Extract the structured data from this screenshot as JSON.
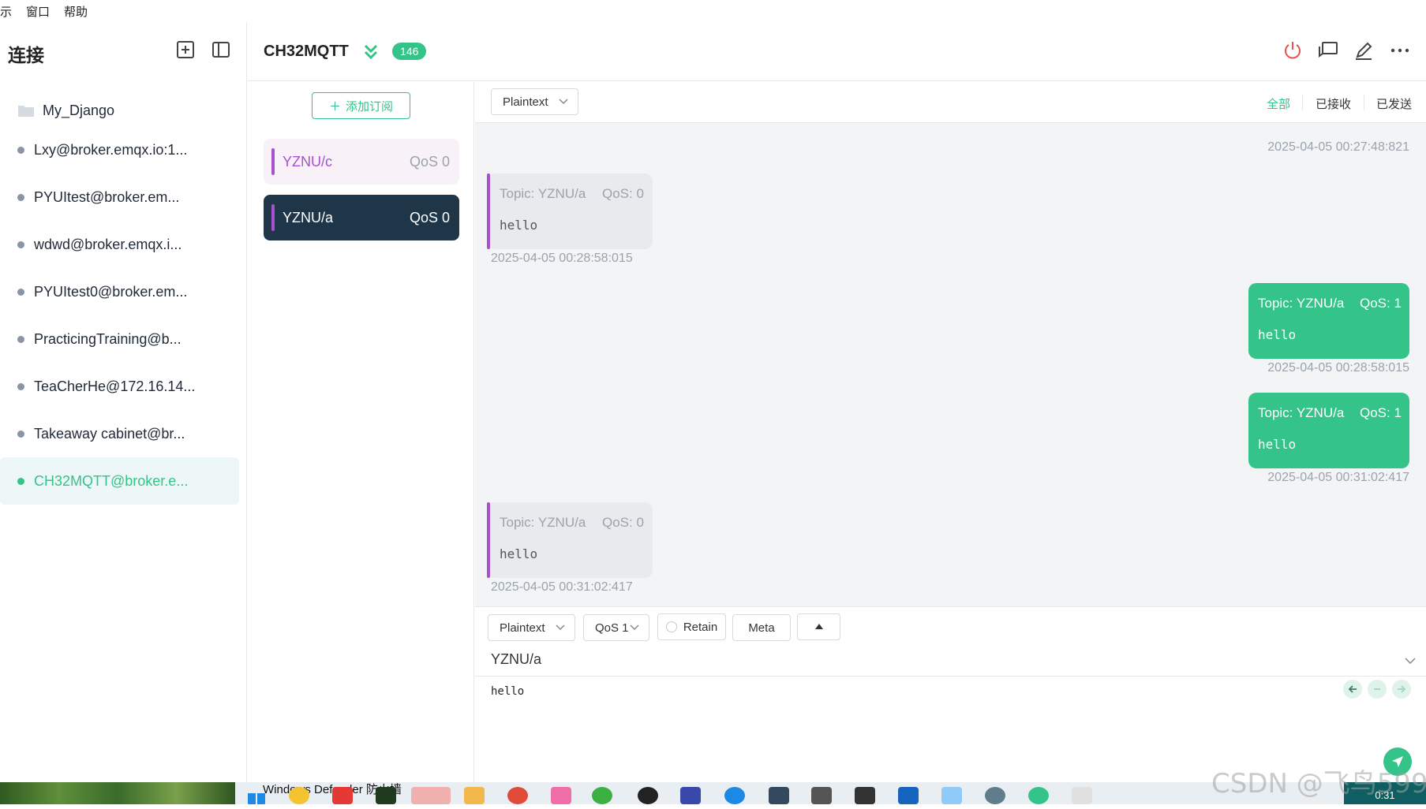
{
  "menubar": {
    "items": [
      "示",
      "窗口",
      "帮助"
    ]
  },
  "sidebar": {
    "title": "连接",
    "folder": {
      "label": "My_Django"
    },
    "connections": [
      {
        "label": "Lxy@broker.emqx.io:1...",
        "active": false
      },
      {
        "label": "PYUItest@broker.em...",
        "active": false
      },
      {
        "label": "wdwd@broker.emqx.i...",
        "active": false
      },
      {
        "label": "PYUItest0@broker.em...",
        "active": false
      },
      {
        "label": "PracticingTraining@b...",
        "active": false
      },
      {
        "label": "TeaCherHe@172.16.14...",
        "active": false
      },
      {
        "label": "Takeaway cabinet@br...",
        "active": false
      },
      {
        "label": "CH32MQTT@broker.e...",
        "active": true
      }
    ]
  },
  "header": {
    "title": "CH32MQTT",
    "message_count": "146"
  },
  "subscriptions": {
    "add_label": "添加订阅",
    "items": [
      {
        "topic": "YZNU/c",
        "qos": "QoS 0"
      },
      {
        "topic": "YZNU/a",
        "qos": "QoS 0"
      }
    ]
  },
  "messages": {
    "format": "Plaintext",
    "filters": [
      "全部",
      "已接收",
      "已发送"
    ],
    "selected_filter": "全部",
    "list": [
      {
        "direction": "out",
        "timestamp": "2025-04-05 00:27:48:821"
      },
      {
        "direction": "in",
        "topic": "Topic: YZNU/a",
        "qos": "QoS: 0",
        "payload": "hello",
        "timestamp": "2025-04-05 00:28:58:015"
      },
      {
        "direction": "out",
        "topic": "Topic: YZNU/a",
        "qos": "QoS: 1",
        "payload": "hello",
        "timestamp": "2025-04-05 00:28:58:015"
      },
      {
        "direction": "out",
        "topic": "Topic: YZNU/a",
        "qos": "QoS: 1",
        "payload": "hello",
        "timestamp": "2025-04-05 00:31:02:417"
      },
      {
        "direction": "in",
        "topic": "Topic: YZNU/a",
        "qos": "QoS: 0",
        "payload": "hello",
        "timestamp": "2025-04-05 00:31:02:417"
      }
    ]
  },
  "composer": {
    "format": "Plaintext",
    "qos": "QoS 1",
    "retain_label": "Retain",
    "meta_label": "Meta",
    "topic": "YZNU/a",
    "payload": "hello"
  },
  "taskbar": {
    "tooltip": "Windows Defender 防火墙",
    "clock": "0:31"
  },
  "watermark": "CSDN @飞鸟599",
  "colors": {
    "accent": "#34c388",
    "topic_purple": "#a751d0",
    "dark_item": "#1f3649",
    "danger": "#e5534b"
  }
}
